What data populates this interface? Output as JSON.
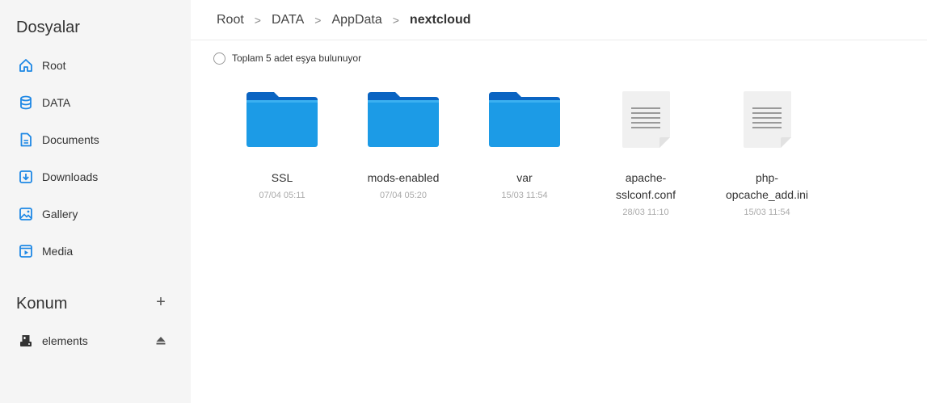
{
  "sidebar": {
    "title": "Dosyalar",
    "items": [
      {
        "label": "Root",
        "icon": "home-icon"
      },
      {
        "label": "DATA",
        "icon": "database-icon"
      },
      {
        "label": "Documents",
        "icon": "document-icon"
      },
      {
        "label": "Downloads",
        "icon": "download-icon"
      },
      {
        "label": "Gallery",
        "icon": "image-icon"
      },
      {
        "label": "Media",
        "icon": "media-icon"
      }
    ],
    "location_title": "Konum",
    "add_label": "+",
    "locations": [
      {
        "label": "elements",
        "icon": "drive-icon"
      }
    ]
  },
  "breadcrumb": {
    "items": [
      "Root",
      "DATA",
      "AppData"
    ],
    "current": "nextcloud",
    "separator": ">"
  },
  "summary": {
    "text": "Toplam 5 adet eşya bulunuyor"
  },
  "files": [
    {
      "name": "SSL",
      "date": "07/04 05:11",
      "type": "folder"
    },
    {
      "name": "mods-enabled",
      "date": "07/04 05:20",
      "type": "folder"
    },
    {
      "name": "var",
      "date": "15/03 11:54",
      "type": "folder"
    },
    {
      "name": "apache-sslconf.conf",
      "name_line1": "apache-",
      "name_line2": "sslconf.conf",
      "date": "28/03 11:10",
      "type": "file"
    },
    {
      "name": "php-opcache_add.ini",
      "name_line1": "php-",
      "name_line2": "opcache_add.ini",
      "date": "15/03 11:54",
      "type": "file"
    }
  ],
  "colors": {
    "accent": "#1e88e5",
    "folder_front": "#1c9be6",
    "folder_back": "#0a64c2",
    "sidebar_bg": "#f5f5f5"
  }
}
